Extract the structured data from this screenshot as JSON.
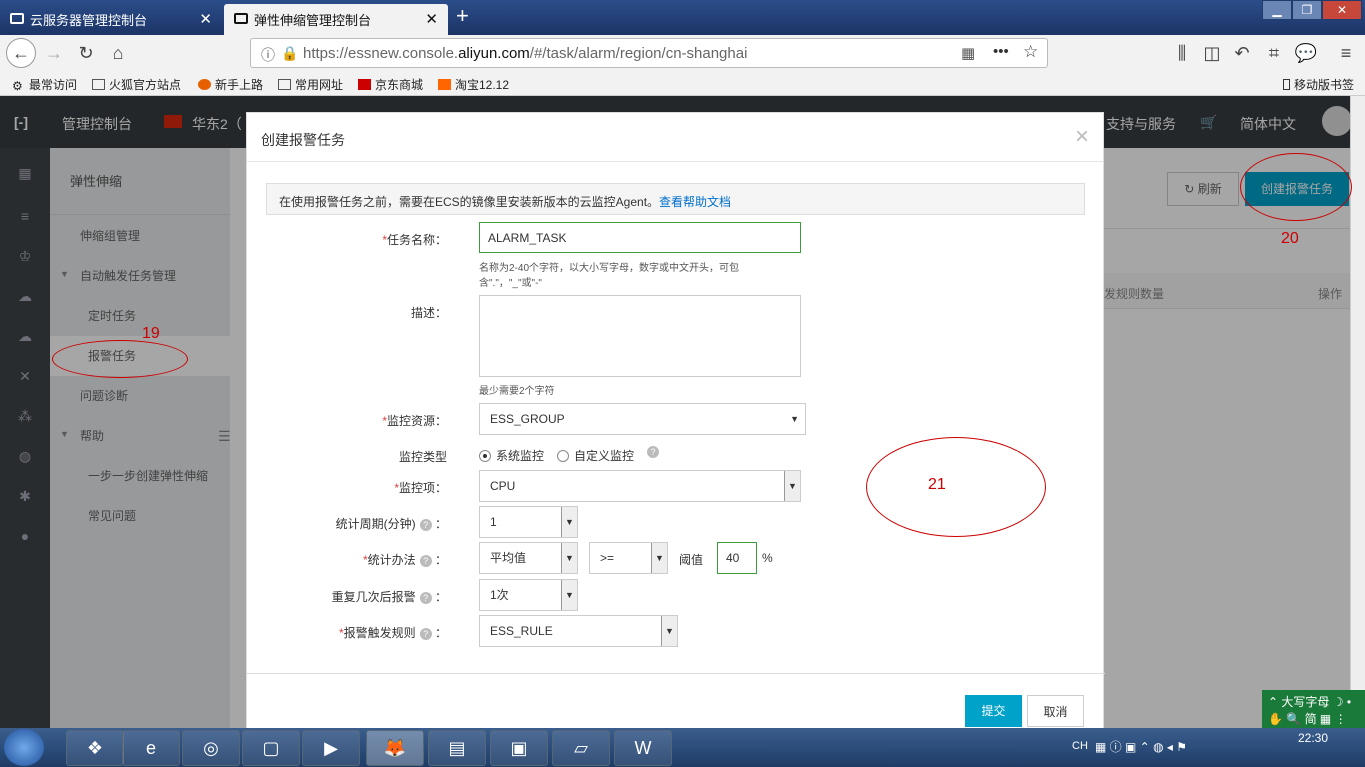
{
  "browser": {
    "tabs": [
      {
        "label": "云服务器管理控制台"
      },
      {
        "label": "弹性伸缩管理控制台"
      }
    ],
    "url_prefix": "https://essnew.console.",
    "url_domain": "aliyun.com",
    "url_path": "/#/task/alarm/region/cn-shanghai",
    "bookmarks": [
      "最常访问",
      "火狐官方站点",
      "新手上路",
      "常用网址",
      "京东商城",
      "淘宝12.12"
    ],
    "mobile_bookmarks": "移动版书签"
  },
  "topnav": {
    "console": "管理控制台",
    "region": "华东2（",
    "support": "支持与服务",
    "language": "简体中文"
  },
  "sidebar": {
    "title": "弹性伸缩",
    "items": [
      {
        "label": "伸缩组管理"
      },
      {
        "label": "自动触发任务管理"
      },
      {
        "label": "定时任务"
      },
      {
        "label": "报警任务"
      },
      {
        "label": "问题诊断"
      },
      {
        "label": "帮助"
      },
      {
        "label": "一步一步创建弹性伸缩"
      },
      {
        "label": "常见问题"
      }
    ]
  },
  "page": {
    "refresh": "刷新",
    "create": "创建报警任务",
    "col_rules": "发规则数量",
    "col_ops": "操作"
  },
  "dialog": {
    "title": "创建报警任务",
    "notice": "在使用报警任务之前，需要在ECS的镜像里安装新版本的云监控Agent。",
    "notice_link": "查看帮助文档",
    "task_name_label": "任务名称：",
    "task_name_value": "ALARM_TASK",
    "task_name_hint": "名称为2-40个字符，以大小写字母，数字或中文开头，可包含\".\"，\"_\"或\"-\"",
    "desc_label": "描述：",
    "desc_hint": "最少需要2个字符",
    "resource_label": "监控资源：",
    "resource_value": "ESS_GROUP",
    "type_label": "监控类型",
    "type_system": "系统监控",
    "type_custom": "自定义监控",
    "metric_label": "监控项：",
    "metric_value": "CPU",
    "period_label": "统计周期(分钟)",
    "period_value": "1",
    "method_label": "统计办法",
    "method_value": "平均值",
    "op_value": ">=",
    "threshold_label": "阈值",
    "threshold_value": "40",
    "threshold_unit": "%",
    "repeat_label": "重复几次后报警",
    "repeat_value": "1次",
    "rule_label": "报警触发规则",
    "rule_value": "ESS_RULE",
    "submit": "提交",
    "cancel": "取消",
    "colon": "："
  },
  "annotations": {
    "a19": "19",
    "a20": "20",
    "a21": "21"
  },
  "ime": {
    "line1": "大写字母",
    "line2": "简"
  },
  "taskbar": {
    "time": "22:30",
    "ch": "CH"
  },
  "colors": {
    "accent": "#00a2ca",
    "nav": "#373d41",
    "annotation": "#cc0000"
  }
}
